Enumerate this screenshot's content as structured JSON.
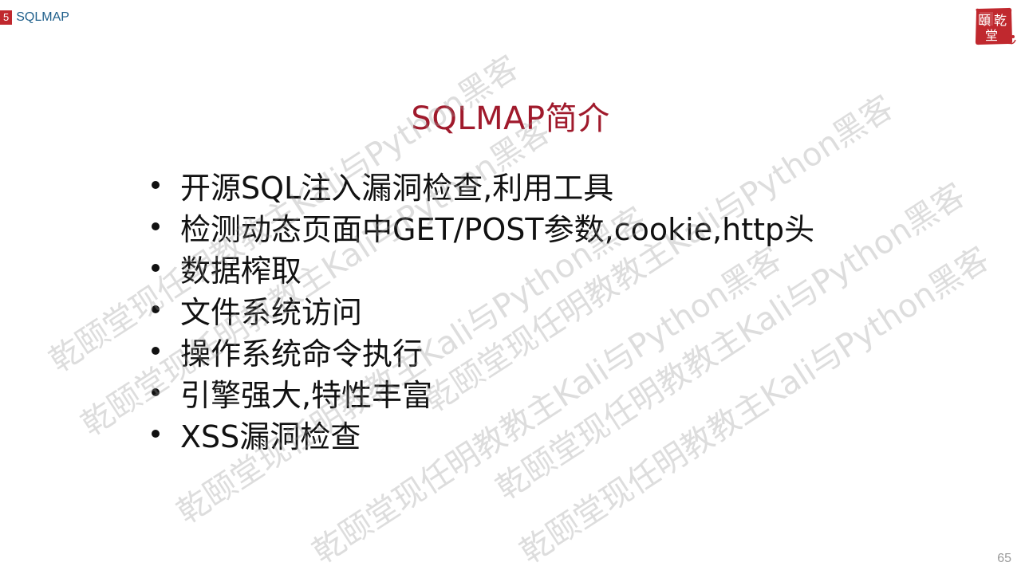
{
  "header": {
    "section_number": "5",
    "section_name": "SQLMAP"
  },
  "logo": {
    "text": "頤乾堂",
    "color": "#c0282e"
  },
  "title": "SQLMAP简介",
  "bullets": [
    "开源SQL注入漏洞检查,利用工具",
    "检测动态页面中GET/POST参数,cookie,http头",
    "数据榨取",
    "文件系统访问",
    "操作系统命令执行",
    "引擎强大,特性丰富",
    "XSS漏洞检查"
  ],
  "watermark": {
    "text": "乾颐堂现任明教教主Kali与Python黑客"
  },
  "page_number": "65",
  "colors": {
    "title": "#a01a2c",
    "section_badge": "#c0282e",
    "section_text": "#1f5f8b"
  }
}
